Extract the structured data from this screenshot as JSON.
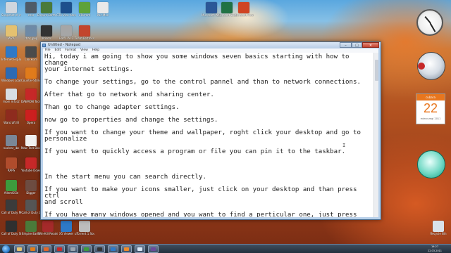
{
  "desktop": {
    "icons": [
      {
        "label": "Snapshot of me 9r",
        "glyph": "#cfd6de"
      },
      {
        "label": "char",
        "glyph": "#4e5b68"
      },
      {
        "label": "Empire Earth",
        "glyph": "#4a7a3a"
      },
      {
        "label": "GTA Vice Adrenaline",
        "glyph": "#1d4f8c"
      },
      {
        "label": "uTorrent",
        "glyph": "#5ea23a"
      },
      {
        "label": "Pac-Man",
        "glyph": "#e9e9e9"
      },
      {
        "label": "Microsoft Word 2010",
        "glyph": "#2b5797"
      },
      {
        "label": "Microsoft Excel 2010",
        "glyph": "#207245"
      },
      {
        "label": "Microsoft PowerPoint",
        "glyph": "#d04423"
      },
      {
        "label": "W7A",
        "glyph": "#e4c170"
      },
      {
        "label": "char jpeg",
        "glyph": "#6e8aa6"
      },
      {
        "label": "Prison",
        "glyph": "#333333"
      },
      {
        "label": "Half Life 2",
        "glyph": "#a6a6a6"
      },
      {
        "label": "Team Fortress 2",
        "glyph": "#c2452d"
      },
      {
        "label": "Internet Explorer",
        "glyph": "#2e79c7"
      },
      {
        "label": "Clocksim",
        "glyph": "#4b4b4b"
      },
      {
        "label": "Windows Loader v2.0",
        "glyph": "#2d6ab3"
      },
      {
        "label": "Counter-Strike Source",
        "glyph": "#e07b1b"
      },
      {
        "label": "mom mfcs2",
        "glyph": "#d8dde3"
      },
      {
        "label": "DAEMON Tools Pro",
        "glyph": "#c62828"
      },
      {
        "label": "Warcraft III",
        "glyph": "#8e2b1e"
      },
      {
        "label": "Opera",
        "glyph": "#cc1f1f"
      },
      {
        "label": "nuclear_ibc",
        "glyph": "#7a8797"
      },
      {
        "label": "New Text Document",
        "glyph": "#f1f1f1"
      },
      {
        "label": "RAPS",
        "glyph": "#b04c2c"
      },
      {
        "label": "Youtube Downloader",
        "glyph": "#c62828"
      },
      {
        "label": "AllemGSie",
        "glyph": "#3d9b3d"
      },
      {
        "label": "Digger",
        "glyph": "#6d4c41"
      },
      {
        "label": "Call of Duty Multiplayer",
        "glyph": "#3b3b3b"
      },
      {
        "label": "Call of Duty 2",
        "glyph": "#555555"
      },
      {
        "label": "Call of Duty Single Player",
        "glyph": "#2f2f2f"
      },
      {
        "label": "Empire Earth",
        "glyph": "#4a7a3a"
      },
      {
        "label": "Win-Kill Reader",
        "glyph": "#a52a2a"
      },
      {
        "label": "X5 Viewer",
        "glyph": "#2e79c7"
      },
      {
        "label": "uTorrent 1 Sound",
        "glyph": "#bdbdbd"
      },
      {
        "label": "Recycle Bin",
        "glyph": "#d9e2ea"
      }
    ]
  },
  "notepad": {
    "title": "Untitled - Notepad",
    "menu": [
      "File",
      "Edit",
      "Format",
      "View",
      "Help"
    ],
    "window_buttons": {
      "minimize": "–",
      "maximize": "□",
      "close": "✕"
    },
    "content": "Hi, today i am going to show you some windows seven basics starting with how to change\nyour internet settings.\n\nTo change your settings, go to the control pannel and than to network connections.\n\nAfter that go to network and sharing center.\n\nThan go to change adapter settings.\n\nnow go to properties and change the settings.\n\nIf you want to change your theme and wallpaper, roght click your desktop and go to\npersonalize\n\nIf you want to quickly access a program or file you can pin it to the taskbar.\n\n\n\nIn the start menu you can search directly.\n\nIf you want to make your icons smaller, just click on your desktop and than press ctrl\nand scroll\n\nIf you have many windows opened and you want to find a perticular one, just press the\nwindows logo button+tab or alt+tab."
  },
  "gadgets": {
    "calendar": {
      "month": "cubara",
      "day": "22",
      "weekday": "miercuregi 2011"
    },
    "colors": {
      "calendar_accent": "#e8761e",
      "gauge": "#169e84"
    }
  },
  "taskbar": {
    "buttons": [
      {
        "name": "explorer",
        "glyph": "#e4c170"
      },
      {
        "name": "media-player",
        "glyph": "#e07b1b"
      },
      {
        "name": "firefox",
        "glyph": "#e0662b"
      },
      {
        "name": "app-red",
        "glyph": "#c62828"
      },
      {
        "name": "app-gray",
        "glyph": "#9aa4ae"
      },
      {
        "name": "app-green",
        "glyph": "#3d9b3d"
      },
      {
        "name": "app-dark",
        "glyph": "#333333"
      },
      {
        "name": "app-blue",
        "glyph": "#2e79c7"
      },
      {
        "name": "app-orange",
        "glyph": "#ef8a2a"
      },
      {
        "name": "notepad",
        "glyph": "#d9e6f5"
      },
      {
        "name": "app-purple",
        "glyph": "#6a4b9c"
      }
    ],
    "clock_time": "19:27",
    "clock_date": "22.03.2011"
  }
}
